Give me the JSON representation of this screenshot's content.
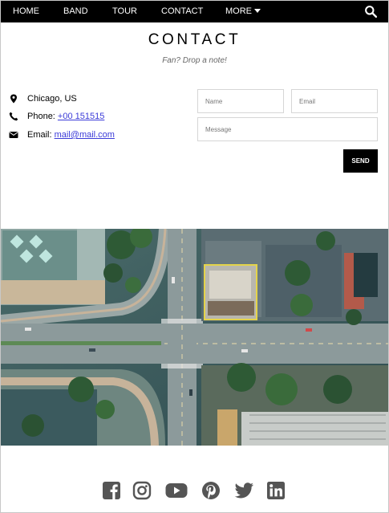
{
  "nav": {
    "items": [
      "HOME",
      "BAND",
      "TOUR",
      "CONTACT"
    ],
    "more_label": "MORE",
    "search_icon": "search-icon"
  },
  "contact": {
    "title": "CONTACT",
    "subtitle": "Fan? Drop a note!",
    "location": "Chicago, US",
    "phone_label": "Phone: ",
    "phone_value": "+00 151515",
    "email_label": "Email: ",
    "email_value": "mail@mail.com"
  },
  "form": {
    "name_placeholder": "Name",
    "email_placeholder": "Email",
    "message_placeholder": "Message",
    "send_label": "SEND"
  },
  "social": [
    "facebook-icon",
    "instagram-icon",
    "youtube-icon",
    "pinterest-icon",
    "twitter-icon",
    "linkedin-icon"
  ],
  "colors": {
    "nav_bg": "#000000",
    "link": "#3b3bd8",
    "icon_gray": "#555555"
  }
}
